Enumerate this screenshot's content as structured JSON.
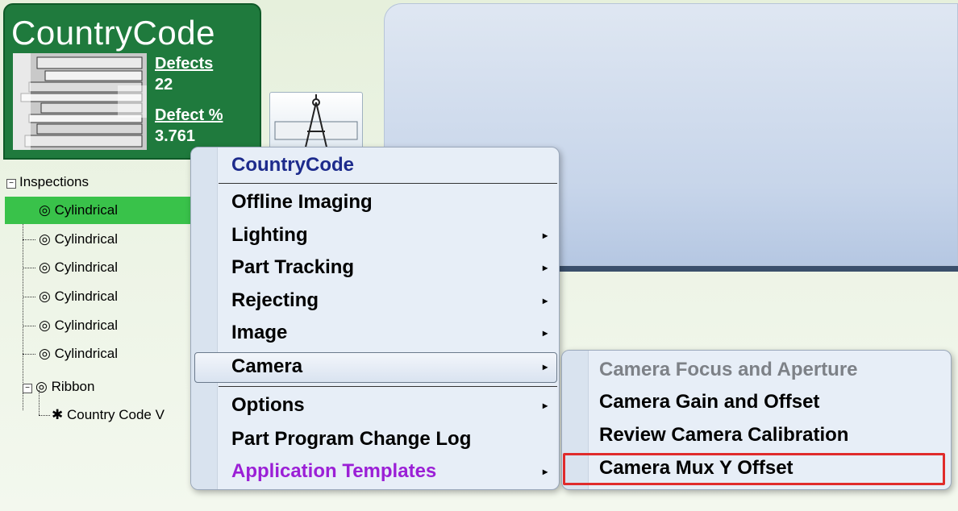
{
  "program": {
    "title": "CountryCode",
    "defects_label": "Defects",
    "defects_value": "22",
    "defect_pct_label": "Defect %",
    "defect_pct_value": "3.761"
  },
  "tree": {
    "header": "Inspections",
    "items": [
      {
        "label": "Cylindrical",
        "selected": true
      },
      {
        "label": "Cylindrical"
      },
      {
        "label": "Cylindrical"
      },
      {
        "label": "Cylindrical"
      },
      {
        "label": "Cylindrical"
      },
      {
        "label": "Cylindrical"
      }
    ],
    "ribbon": "Ribbon",
    "ribbon_child": "Country Code V"
  },
  "menu": {
    "header": "CountryCode",
    "items": [
      {
        "label": "Offline Imaging",
        "submenu": false
      },
      {
        "label": "Lighting",
        "submenu": true
      },
      {
        "label": "Part Tracking",
        "submenu": true
      },
      {
        "label": "Rejecting",
        "submenu": true
      },
      {
        "label": "Image",
        "submenu": true
      },
      {
        "label": "Camera",
        "submenu": true,
        "active": true
      },
      {
        "label": "Options",
        "submenu": true
      },
      {
        "label": "Part Program Change Log",
        "submenu": false
      },
      {
        "label": "Application Templates",
        "submenu": true
      }
    ]
  },
  "submenu": {
    "items": [
      {
        "label": "Camera Focus and Aperture",
        "disabled": true
      },
      {
        "label": "Camera Gain and Offset"
      },
      {
        "label": "Review Camera Calibration"
      },
      {
        "label": "Camera Mux Y Offset",
        "highlighted": true
      }
    ]
  },
  "colors": {
    "card_green": "#1f7a3d",
    "selected_green": "#39c24a",
    "menu_header": "#1d2b8c",
    "templates_purple": "#9b1fd6",
    "highlight_red": "#e02b2b"
  }
}
